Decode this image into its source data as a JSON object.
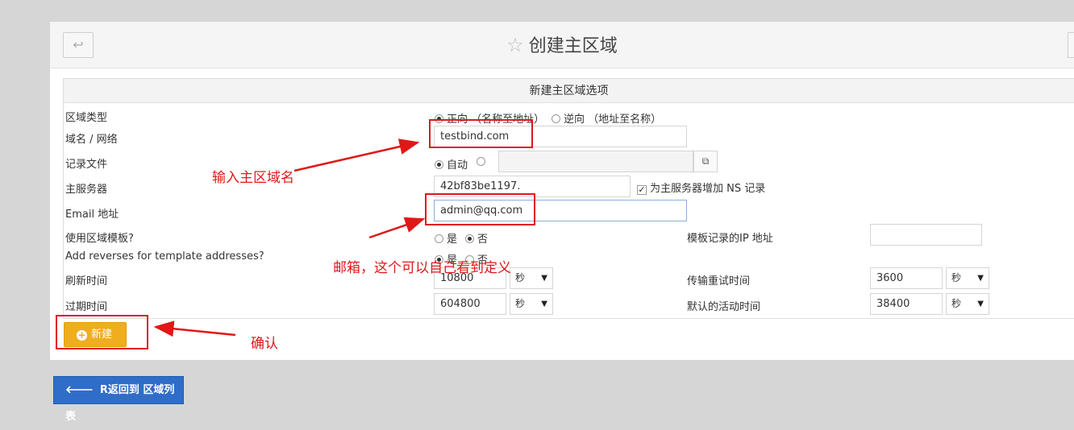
{
  "header": {
    "back_icon": "return-arrow-icon",
    "title": "创建主区域",
    "star_icon": "star-outline-icon"
  },
  "form": {
    "section_title": "新建主区域选项",
    "zone_type": {
      "label": "区域类型",
      "options": [
        "正向 （名称至地址）",
        "逆向 （地址至名称）"
      ],
      "selected": "正向 （名称至地址）"
    },
    "domain": {
      "label": "域名 / 网络",
      "value": "testbind.com"
    },
    "records_file": {
      "label": "记录文件",
      "options": [
        "自动"
      ],
      "selected": "自动",
      "value": ""
    },
    "master_server": {
      "label": "主服务器",
      "value": "42bf83be1197.",
      "checkbox_label": "为主服务器增加 NS 记录",
      "checked": true
    },
    "email": {
      "label": "Email 地址",
      "value": "admin@qq.com"
    },
    "use_template": {
      "label": "使用区域模板?",
      "options": [
        "是",
        "否"
      ],
      "selected": "否"
    },
    "template_ip": {
      "label": "模板记录的IP 地址",
      "value": ""
    },
    "add_reverses": {
      "label": "Add reverses for template addresses?",
      "options": [
        "是",
        "否"
      ]
    },
    "refresh": {
      "label": "刷新时间",
      "value": "10800",
      "unit": "秒"
    },
    "transfer_retry": {
      "label": "传输重试时间",
      "value": "3600",
      "unit": "秒"
    },
    "expiry": {
      "label": "过期时间",
      "value": "604800",
      "unit": "秒"
    },
    "default_ttl": {
      "label": "默认的活动时间",
      "value": "38400",
      "unit": "秒"
    }
  },
  "buttons": {
    "create": "新建",
    "return": "R返回到 区域列表"
  },
  "annotations": {
    "domain_note": "输入主区域名",
    "email_note": "邮箱，这个可以自己看到定义",
    "confirm_note": "确认",
    "color": "#e01818"
  },
  "colors": {
    "create_button": "#f0ad1e",
    "return_button": "#2f6dc8"
  }
}
